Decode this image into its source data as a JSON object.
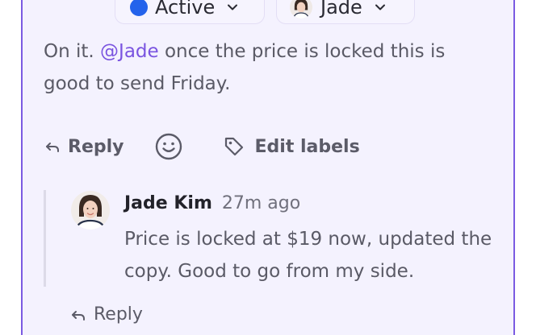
{
  "chips": {
    "status_label": "Active",
    "status_color": "#2463eb",
    "assignee_label": "Jade"
  },
  "comment": {
    "text_before": "On it. ",
    "mention": "@Jade",
    "text_after": " once the price is locked this is good to send Friday."
  },
  "actions": {
    "reply_label": "Reply",
    "emoji_icon": "smile-icon",
    "edit_labels_label": "Edit labels"
  },
  "thread_reply": {
    "author": "Jade Kim",
    "time": "27m ago",
    "body": "Price is locked at $19 now, updated the copy. Good to go from my side.",
    "reply_label": "Reply"
  },
  "colors": {
    "accent": "#7b5be2",
    "mention": "#7a54e0",
    "card_bg": "#f4f2fe"
  }
}
